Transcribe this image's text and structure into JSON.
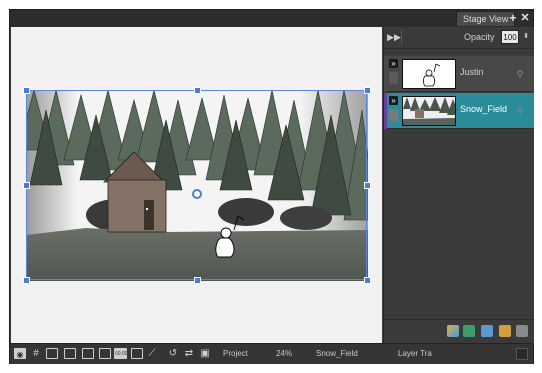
{
  "window": {
    "tab_title": "Stage View",
    "tab_add_glyph": "+",
    "tab_close_glyph": "✕"
  },
  "layer_panel": {
    "opacity_label": "Opacity",
    "opacity_value": "100",
    "layers": [
      {
        "name": "Justin",
        "selected": false
      },
      {
        "name": "Snow_Field",
        "selected": true
      }
    ]
  },
  "status_bar": {
    "project_label": "Project",
    "zoom_label": "24%",
    "drawing_label": "Snow_Field",
    "layer_label": "Layer Tra"
  },
  "colors": {
    "accent_selection": "#4a7ce0",
    "layer_selected": "#2a8c9a",
    "layer_marker": "#6a3fa0"
  },
  "icons": [
    "fast-forward-icon",
    "eye-icon",
    "lock-icon",
    "link-icon",
    "camera-icon",
    "grid-icon",
    "safe-area-icon",
    "trash-icon",
    "add-layer-icon",
    "image-layer-icon",
    "duplicate-layer-icon",
    "folder-layer-icon"
  ]
}
